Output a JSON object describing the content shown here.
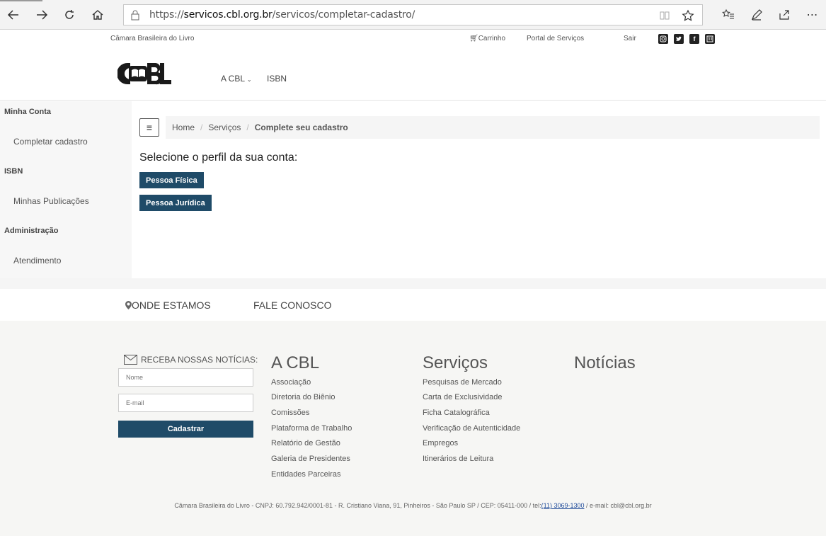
{
  "browser": {
    "url_scheme": "https://",
    "url_host": "servicos.cbl.org.br",
    "url_path": "/servicos/completar-cadastro/"
  },
  "header": {
    "org_name": "Câmara Brasileira do Livro",
    "cart_label": "Carrinho",
    "portal_label": "Portal de Serviços",
    "logout_label": "Sair",
    "logo_text": "CBL",
    "nav": [
      {
        "label": "A CBL"
      },
      {
        "label": "ISBN"
      }
    ]
  },
  "sidebar": {
    "sections": [
      {
        "title": "Minha Conta",
        "items": [
          "Completar cadastro"
        ]
      },
      {
        "title": "ISBN",
        "items": [
          "Minhas Publicações"
        ]
      },
      {
        "title": "Administração",
        "items": [
          "Atendimento"
        ]
      }
    ]
  },
  "breadcrumb": {
    "home": "Home",
    "services": "Serviços",
    "current": "Complete seu cadastro"
  },
  "main": {
    "prompt": "Selecione o perfil da sua conta:",
    "btn_fisica": "Pessoa Física",
    "btn_juridica": "Pessoa Jurídica"
  },
  "links_strip": {
    "onde": "ONDE ESTAMOS",
    "fale": "FALE CONOSCO"
  },
  "footer": {
    "newsletter_title": "RECEBA NOSSAS NOTÍCIAS:",
    "name_placeholder": "Nome",
    "email_placeholder": "E-mail",
    "submit_label": "Cadastrar",
    "col_cbl": {
      "title": "A CBL",
      "items": [
        "Associação",
        "Diretoria do Biênio",
        "Comissões",
        "Plataforma de Trabalho",
        "Relatório de Gestão",
        "Galeria de Presidentes",
        "Entidades Parceiras"
      ]
    },
    "col_servicos": {
      "title": "Serviços",
      "items": [
        "Pesquisas de Mercado",
        "Carta de Exclusividade",
        "Ficha Catalográfica",
        "Verificação de Autenticidade",
        "Empregos",
        "Itinerários de Leitura"
      ]
    },
    "col_noticias": {
      "title": "Notícias"
    },
    "copyright_pre": "Câmara Brasileira do Livro - CNPJ: 60.792.942/0001-81 - R. Cristiano Viana, 91, Pinheiros - São Paulo SP / CEP: 05411-000 / tel:",
    "phone": "(11) 3069-1300",
    "copyright_post": " / e-mail: cbl@cbl.org.br"
  },
  "colors": {
    "accent": "#1f4b68"
  }
}
